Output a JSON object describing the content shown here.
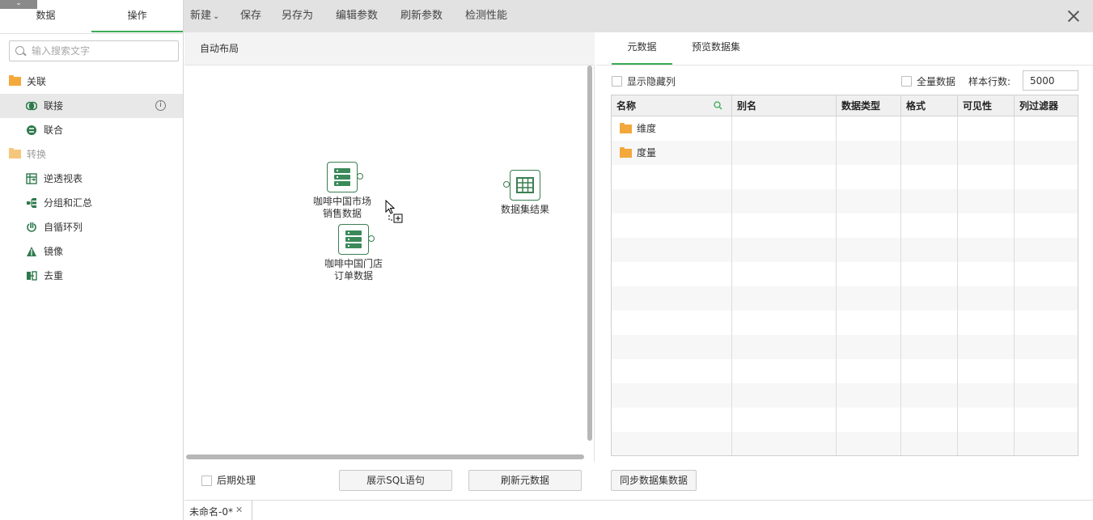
{
  "left_panel": {
    "tabs": [
      "数据",
      "操作"
    ],
    "active_tab": "操作",
    "search_placeholder": "输入搜索文字",
    "groups": [
      {
        "label": "关联",
        "items": [
          {
            "label": "联接",
            "icon": "join-icon"
          },
          {
            "label": "联合",
            "icon": "union-icon"
          }
        ]
      },
      {
        "label": "转换",
        "items": [
          {
            "label": "逆透视表",
            "icon": "unpivot-icon"
          },
          {
            "label": "分组和汇总",
            "icon": "group-aggregate-icon"
          },
          {
            "label": "自循环列",
            "icon": "self-loop-icon"
          },
          {
            "label": "镜像",
            "icon": "mirror-icon"
          },
          {
            "label": "去重",
            "icon": "dedupe-icon"
          }
        ]
      }
    ],
    "info_glyph": "i"
  },
  "toolbar": {
    "new_label": "新建",
    "new_caret": "⌄",
    "save_label": "保存",
    "save_as_label": "另存为",
    "edit_params_label": "编辑参数",
    "refresh_params_label": "刷新参数",
    "check_perf_label": "检测性能"
  },
  "canvas": {
    "auto_layout_label": "自动布局",
    "nodes": [
      {
        "label_line1": "咖啡中国市场",
        "label_line2": "销售数据"
      },
      {
        "label_line1": "咖啡中国门店",
        "label_line2": "订单数据"
      },
      {
        "label_line1": "数据集结果",
        "label_line2": ""
      }
    ],
    "post_process_label": "后期处理",
    "show_sql_label": "展示SQL语句",
    "refresh_meta_label": "刷新元数据"
  },
  "right_panel": {
    "tabs": [
      "元数据",
      "预览数据集"
    ],
    "active_tab": "元数据",
    "show_hidden_label": "显示隐藏列",
    "all_data_label": "全量数据",
    "sample_rows_label": "样本行数:",
    "sample_rows_value": "5000",
    "columns": [
      "名称",
      "别名",
      "数据类型",
      "格式",
      "可见性",
      "列过滤器"
    ],
    "rows": [
      {
        "name": "维度",
        "type": "folder"
      },
      {
        "name": "度量",
        "type": "folder"
      }
    ],
    "sync_button_label": "同步数据集数据"
  },
  "bottom_tabs": [
    {
      "label": "未命名-0*",
      "close": "✕"
    }
  ],
  "colors": {
    "accent": "#3bab56",
    "node": "#3b7f52",
    "folder": "#f3a83b"
  }
}
